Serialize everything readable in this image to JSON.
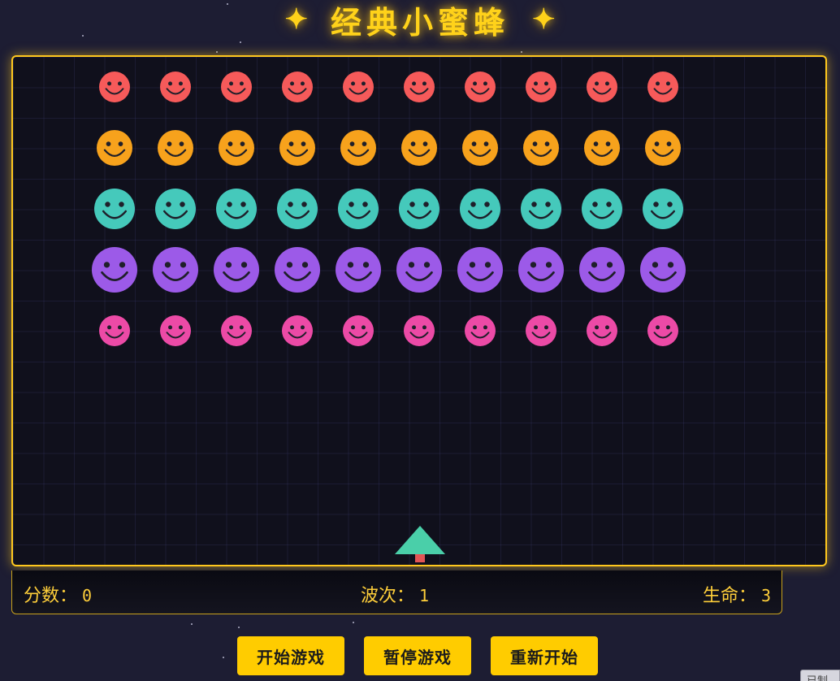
{
  "title": {
    "text": "经典小蜜蜂",
    "left_sparkle": "✦",
    "right_sparkle": "✦"
  },
  "game": {
    "enemy_rows": [
      {
        "color": "#f65a5a",
        "count": 10
      },
      {
        "color": "#f7a21c",
        "count": 10
      },
      {
        "color": "#45c9bb",
        "count": 10
      },
      {
        "color": "#9c5ae8",
        "count": 10
      },
      {
        "color": "#ec4aa6",
        "count": 10
      }
    ],
    "player": {
      "body_color": "#4acfa9",
      "base_color": "#e25555"
    }
  },
  "hud": {
    "score_label": "分数：",
    "score_value": "0",
    "wave_label": "波次：",
    "wave_value": "1",
    "lives_label": "生命：",
    "lives_value": "3"
  },
  "controls": {
    "start_label": "开始游戏",
    "pause_label": "暂停游戏",
    "restart_label": "重新开始"
  },
  "corner_tag": "已制"
}
